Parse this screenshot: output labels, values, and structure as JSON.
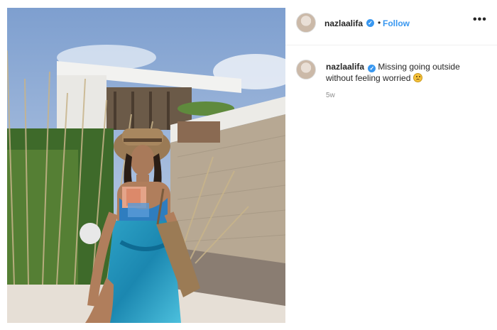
{
  "post": {
    "image_alt": "woman in hat and blue skirt in front of house",
    "author": {
      "username": "nazlaalifa",
      "verified": true,
      "verified_color": "#3897f0"
    },
    "header": {
      "separator": "•",
      "follow_label": "Follow",
      "more_label": "•••"
    },
    "caption": {
      "username": "nazlaalifa",
      "text": "Missing going outside without feeling worried",
      "emoji": "worried-face-emoji"
    },
    "time_ago": "5w"
  }
}
